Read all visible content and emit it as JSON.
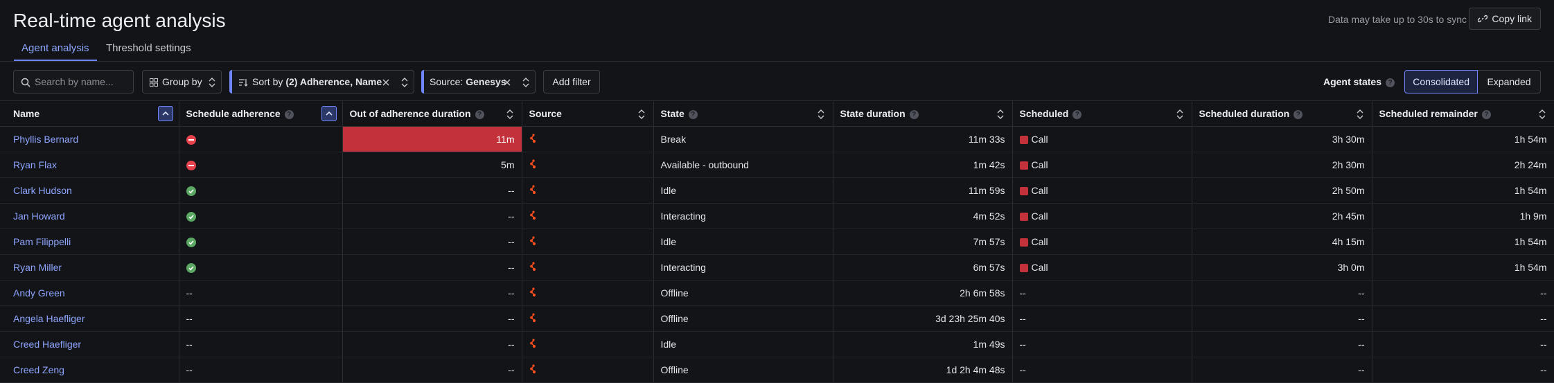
{
  "header": {
    "title": "Real-time agent analysis",
    "sync_note": "Data may take up to 30s to sync",
    "copy_link": "Copy link"
  },
  "tabs": [
    {
      "label": "Agent analysis",
      "active": true
    },
    {
      "label": "Threshold settings",
      "active": false
    }
  ],
  "toolbar": {
    "search_placeholder": "Search by name...",
    "group_by": "Group by",
    "sort_prefix": "Sort by",
    "sort_value": "(2) Adherence, Name",
    "source_prefix": "Source:",
    "source_value": "Genesys",
    "add_filter": "Add filter",
    "agent_states_label": "Agent states",
    "agent_states_options": [
      "Consolidated",
      "Expanded"
    ],
    "agent_states_selected": "Consolidated"
  },
  "columns": [
    "Name",
    "Schedule adherence",
    "Out of adherence duration",
    "Source",
    "State",
    "State duration",
    "Scheduled",
    "Scheduled duration",
    "Scheduled remainder"
  ],
  "rows": [
    {
      "name": "Phyllis Bernard",
      "adherence": "out",
      "ooa": "11m",
      "ooa_alert": true,
      "state": "Break",
      "state_duration": "11m 33s",
      "scheduled": "Call",
      "scheduled_duration": "3h 30m",
      "scheduled_remainder": "1h 54m"
    },
    {
      "name": "Ryan Flax",
      "adherence": "out",
      "ooa": "5m",
      "ooa_alert": false,
      "state": "Available - outbound",
      "state_duration": "1m 42s",
      "scheduled": "Call",
      "scheduled_duration": "2h 30m",
      "scheduled_remainder": "2h 24m"
    },
    {
      "name": "Clark Hudson",
      "adherence": "in",
      "ooa": "--",
      "ooa_alert": false,
      "state": "Idle",
      "state_duration": "11m 59s",
      "scheduled": "Call",
      "scheduled_duration": "2h 50m",
      "scheduled_remainder": "1h 54m"
    },
    {
      "name": "Jan Howard",
      "adherence": "in",
      "ooa": "--",
      "ooa_alert": false,
      "state": "Interacting",
      "state_duration": "4m 52s",
      "scheduled": "Call",
      "scheduled_duration": "2h 45m",
      "scheduled_remainder": "1h 9m"
    },
    {
      "name": "Pam Filippelli",
      "adherence": "in",
      "ooa": "--",
      "ooa_alert": false,
      "state": "Idle",
      "state_duration": "7m 57s",
      "scheduled": "Call",
      "scheduled_duration": "4h 15m",
      "scheduled_remainder": "1h 54m"
    },
    {
      "name": "Ryan Miller",
      "adherence": "in",
      "ooa": "--",
      "ooa_alert": false,
      "state": "Interacting",
      "state_duration": "6m 57s",
      "scheduled": "Call",
      "scheduled_duration": "3h 0m",
      "scheduled_remainder": "1h 54m"
    },
    {
      "name": "Andy Green",
      "adherence": "none",
      "adherence_text": "--",
      "ooa": "--",
      "ooa_alert": false,
      "state": "Offline",
      "state_duration": "2h 6m 58s",
      "scheduled": "--",
      "scheduled_duration": "--",
      "scheduled_remainder": "--"
    },
    {
      "name": "Angela Haefliger",
      "adherence": "none",
      "adherence_text": "--",
      "ooa": "--",
      "ooa_alert": false,
      "state": "Offline",
      "state_duration": "3d 23h 25m 40s",
      "scheduled": "--",
      "scheduled_duration": "--",
      "scheduled_remainder": "--"
    },
    {
      "name": "Creed Haefliger",
      "adherence": "none",
      "adherence_text": "--",
      "ooa": "--",
      "ooa_alert": false,
      "state": "Idle",
      "state_duration": "1m 49s",
      "scheduled": "--",
      "scheduled_duration": "--",
      "scheduled_remainder": "--"
    },
    {
      "name": "Creed Zeng",
      "adherence": "none",
      "adherence_text": "--",
      "ooa": "--",
      "ooa_alert": false,
      "state": "Offline",
      "state_duration": "1d 2h 4m 48s",
      "scheduled": "--",
      "scheduled_duration": "--",
      "scheduled_remainder": "--"
    }
  ],
  "colors": {
    "accent": "#6f86ff",
    "alert_red": "#c3313b",
    "in_adherence_green": "#5aa863",
    "source_orange": "#ff4f1f"
  }
}
